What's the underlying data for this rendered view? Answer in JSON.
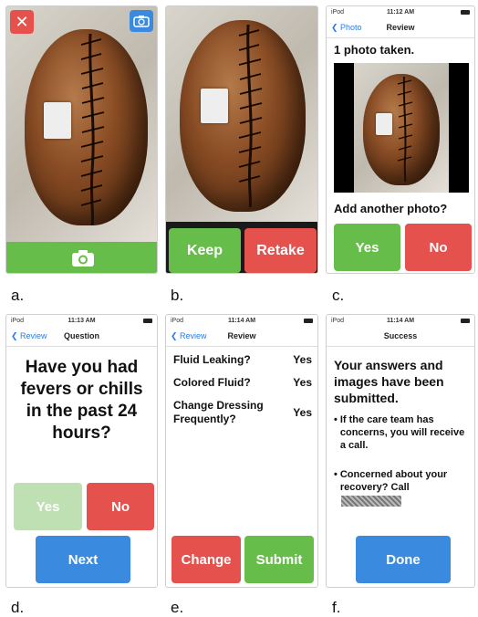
{
  "captions": [
    "a.",
    "b.",
    "c.",
    "d.",
    "e.",
    "f."
  ],
  "panel_a": {
    "close_icon": "close-icon",
    "switch_camera_icon": "camera-switch-icon",
    "camera_icon": "camera-icon"
  },
  "panel_b": {
    "keep_label": "Keep",
    "retake_label": "Retake"
  },
  "panel_c": {
    "status": {
      "carrier": "iPod",
      "time": "11:12 AM"
    },
    "nav": {
      "back": "Photo",
      "title": "Review"
    },
    "photos_taken": "1 photo taken.",
    "question": "Add another photo?",
    "yes_label": "Yes",
    "no_label": "No"
  },
  "panel_d": {
    "status": {
      "carrier": "iPod",
      "time": "11:13 AM"
    },
    "nav": {
      "back": "Review",
      "title": "Question"
    },
    "question": "Have you had fevers or chills in the past 24 hours?",
    "yes_label": "Yes",
    "no_label": "No",
    "next_label": "Next"
  },
  "panel_e": {
    "status": {
      "carrier": "iPod",
      "time": "11:14 AM"
    },
    "nav": {
      "back": "Review",
      "title": "Review"
    },
    "answers": [
      {
        "question": "Fluid Leaking?",
        "answer": "Yes"
      },
      {
        "question": "Colored Fluid?",
        "answer": "Yes"
      },
      {
        "question": "Change Dressing Frequently?",
        "answer": "Yes"
      }
    ],
    "change_label": "Change",
    "submit_label": "Submit"
  },
  "panel_f": {
    "status": {
      "carrier": "iPod",
      "time": "11:14 AM"
    },
    "nav": {
      "title": "Success"
    },
    "message": "Your answers and images have been submitted.",
    "bullet1": "If the care team has concerns, you will receive a call.",
    "bullet2": "Concerned about your recovery? Call",
    "done_label": "Done"
  },
  "colors": {
    "green": "#67bd4a",
    "red": "#e5524e",
    "blue": "#3a8be0",
    "ios_blue": "#2a7de1"
  }
}
